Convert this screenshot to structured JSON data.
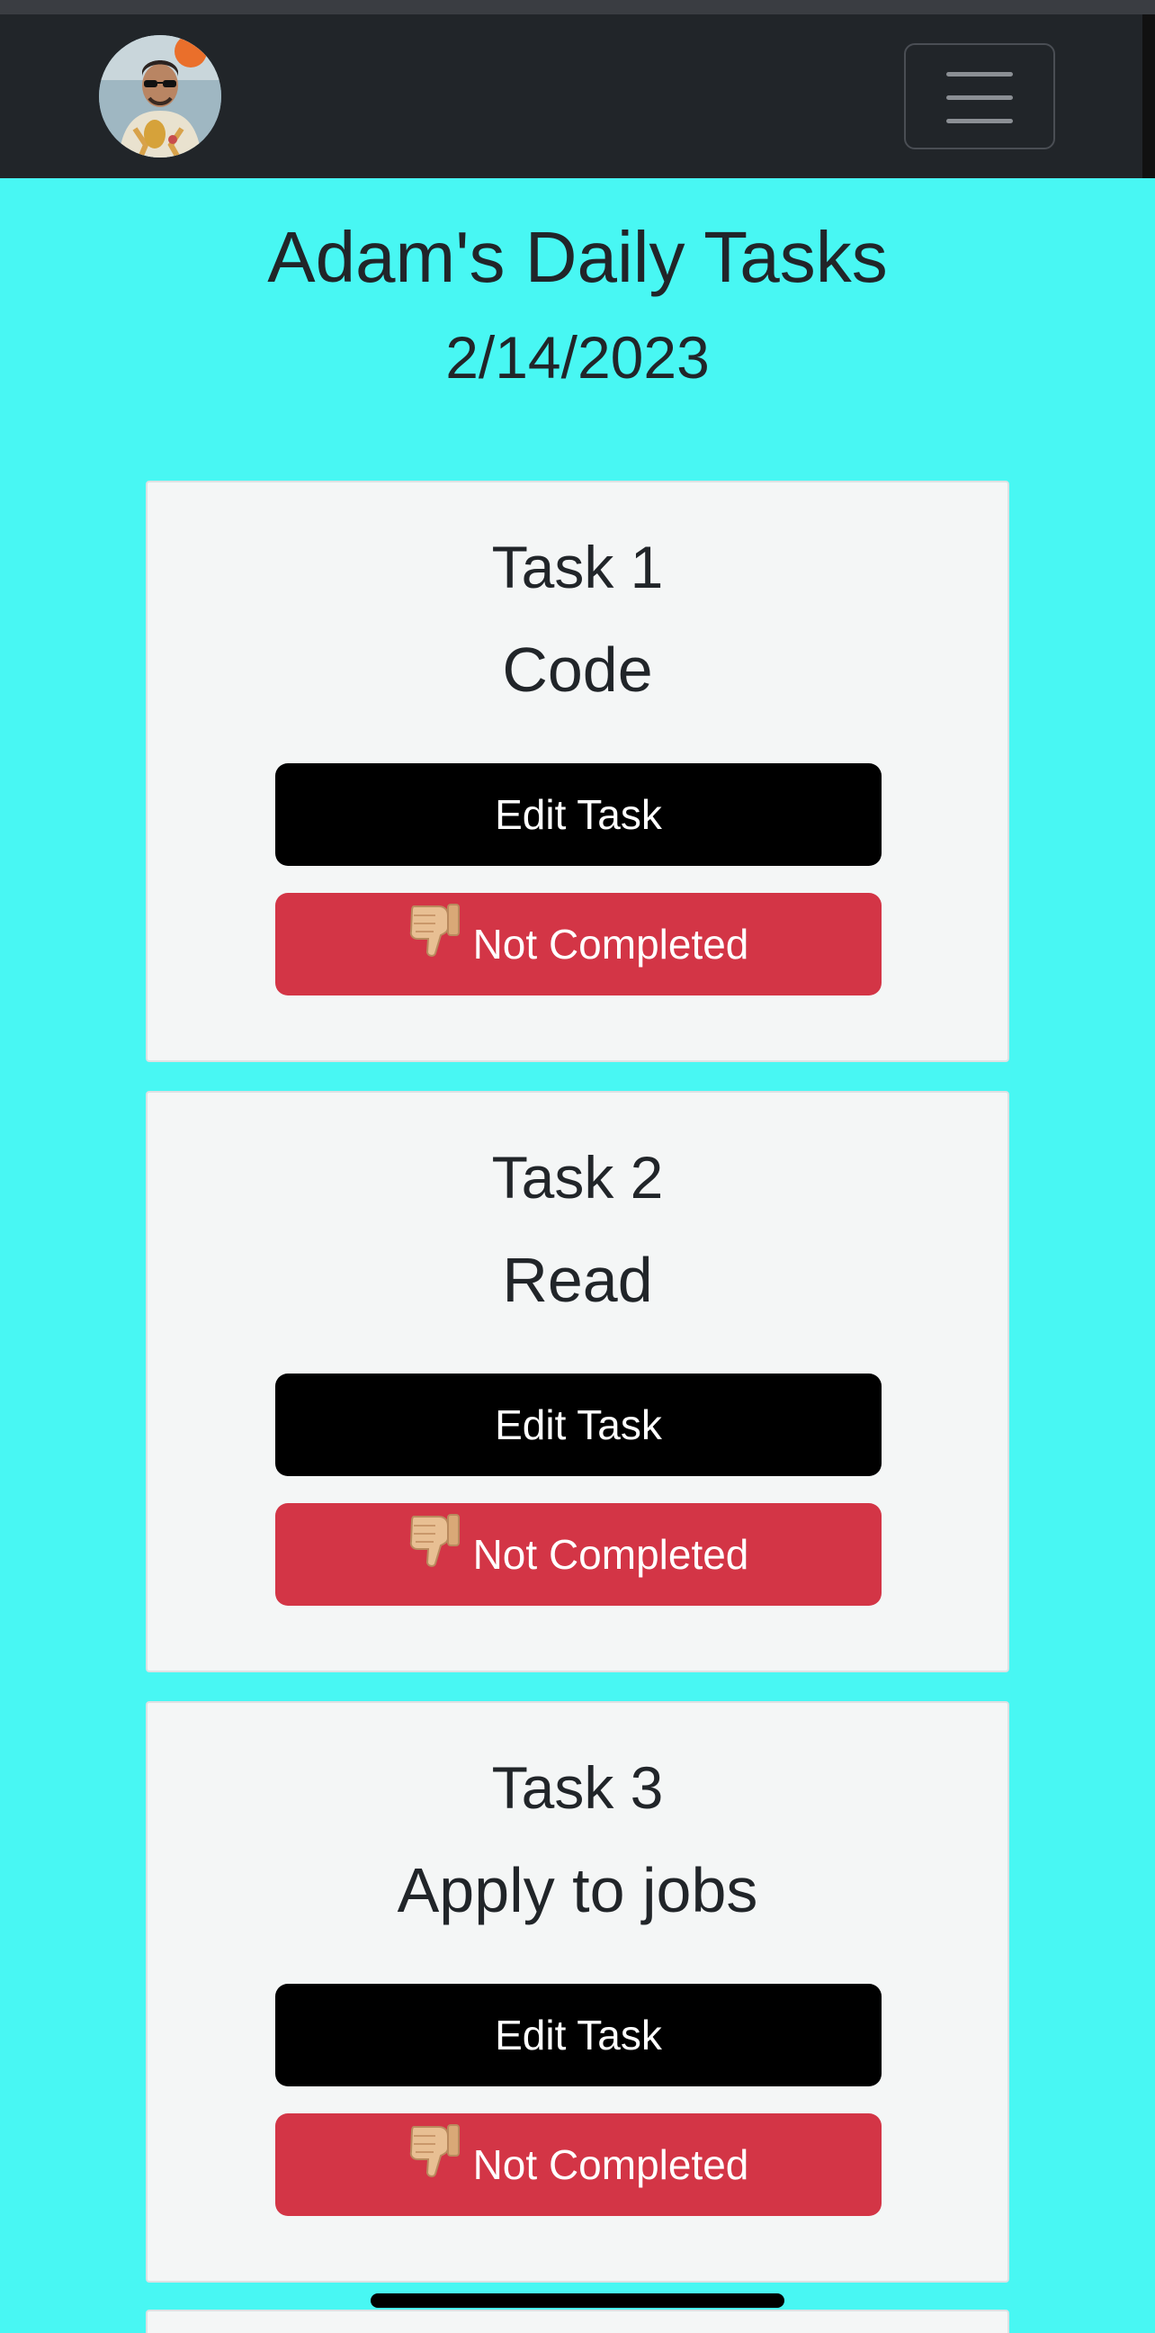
{
  "navbar": {
    "avatar_icon": "user-avatar-photo",
    "menu_icon": "hamburger-menu-icon"
  },
  "header": {
    "title": "Adam's Daily Tasks",
    "date": "2/14/2023"
  },
  "tasks": [
    {
      "number_label": "Task 1",
      "name": "Code",
      "edit_label": "Edit Task",
      "status_label": "Not Completed",
      "status_icon": "thumbs-down-icon"
    },
    {
      "number_label": "Task 2",
      "name": "Read",
      "edit_label": "Edit Task",
      "status_label": "Not Completed",
      "status_icon": "thumbs-down-icon"
    },
    {
      "number_label": "Task 3",
      "name": "Apply to jobs",
      "edit_label": "Edit Task",
      "status_label": "Not Completed",
      "status_icon": "thumbs-down-icon"
    }
  ],
  "colors": {
    "page_background": "#48f7f3",
    "navbar_background": "#212529",
    "card_background": "#f4f6f6",
    "edit_button": "#000000",
    "status_button": "#d33546"
  }
}
